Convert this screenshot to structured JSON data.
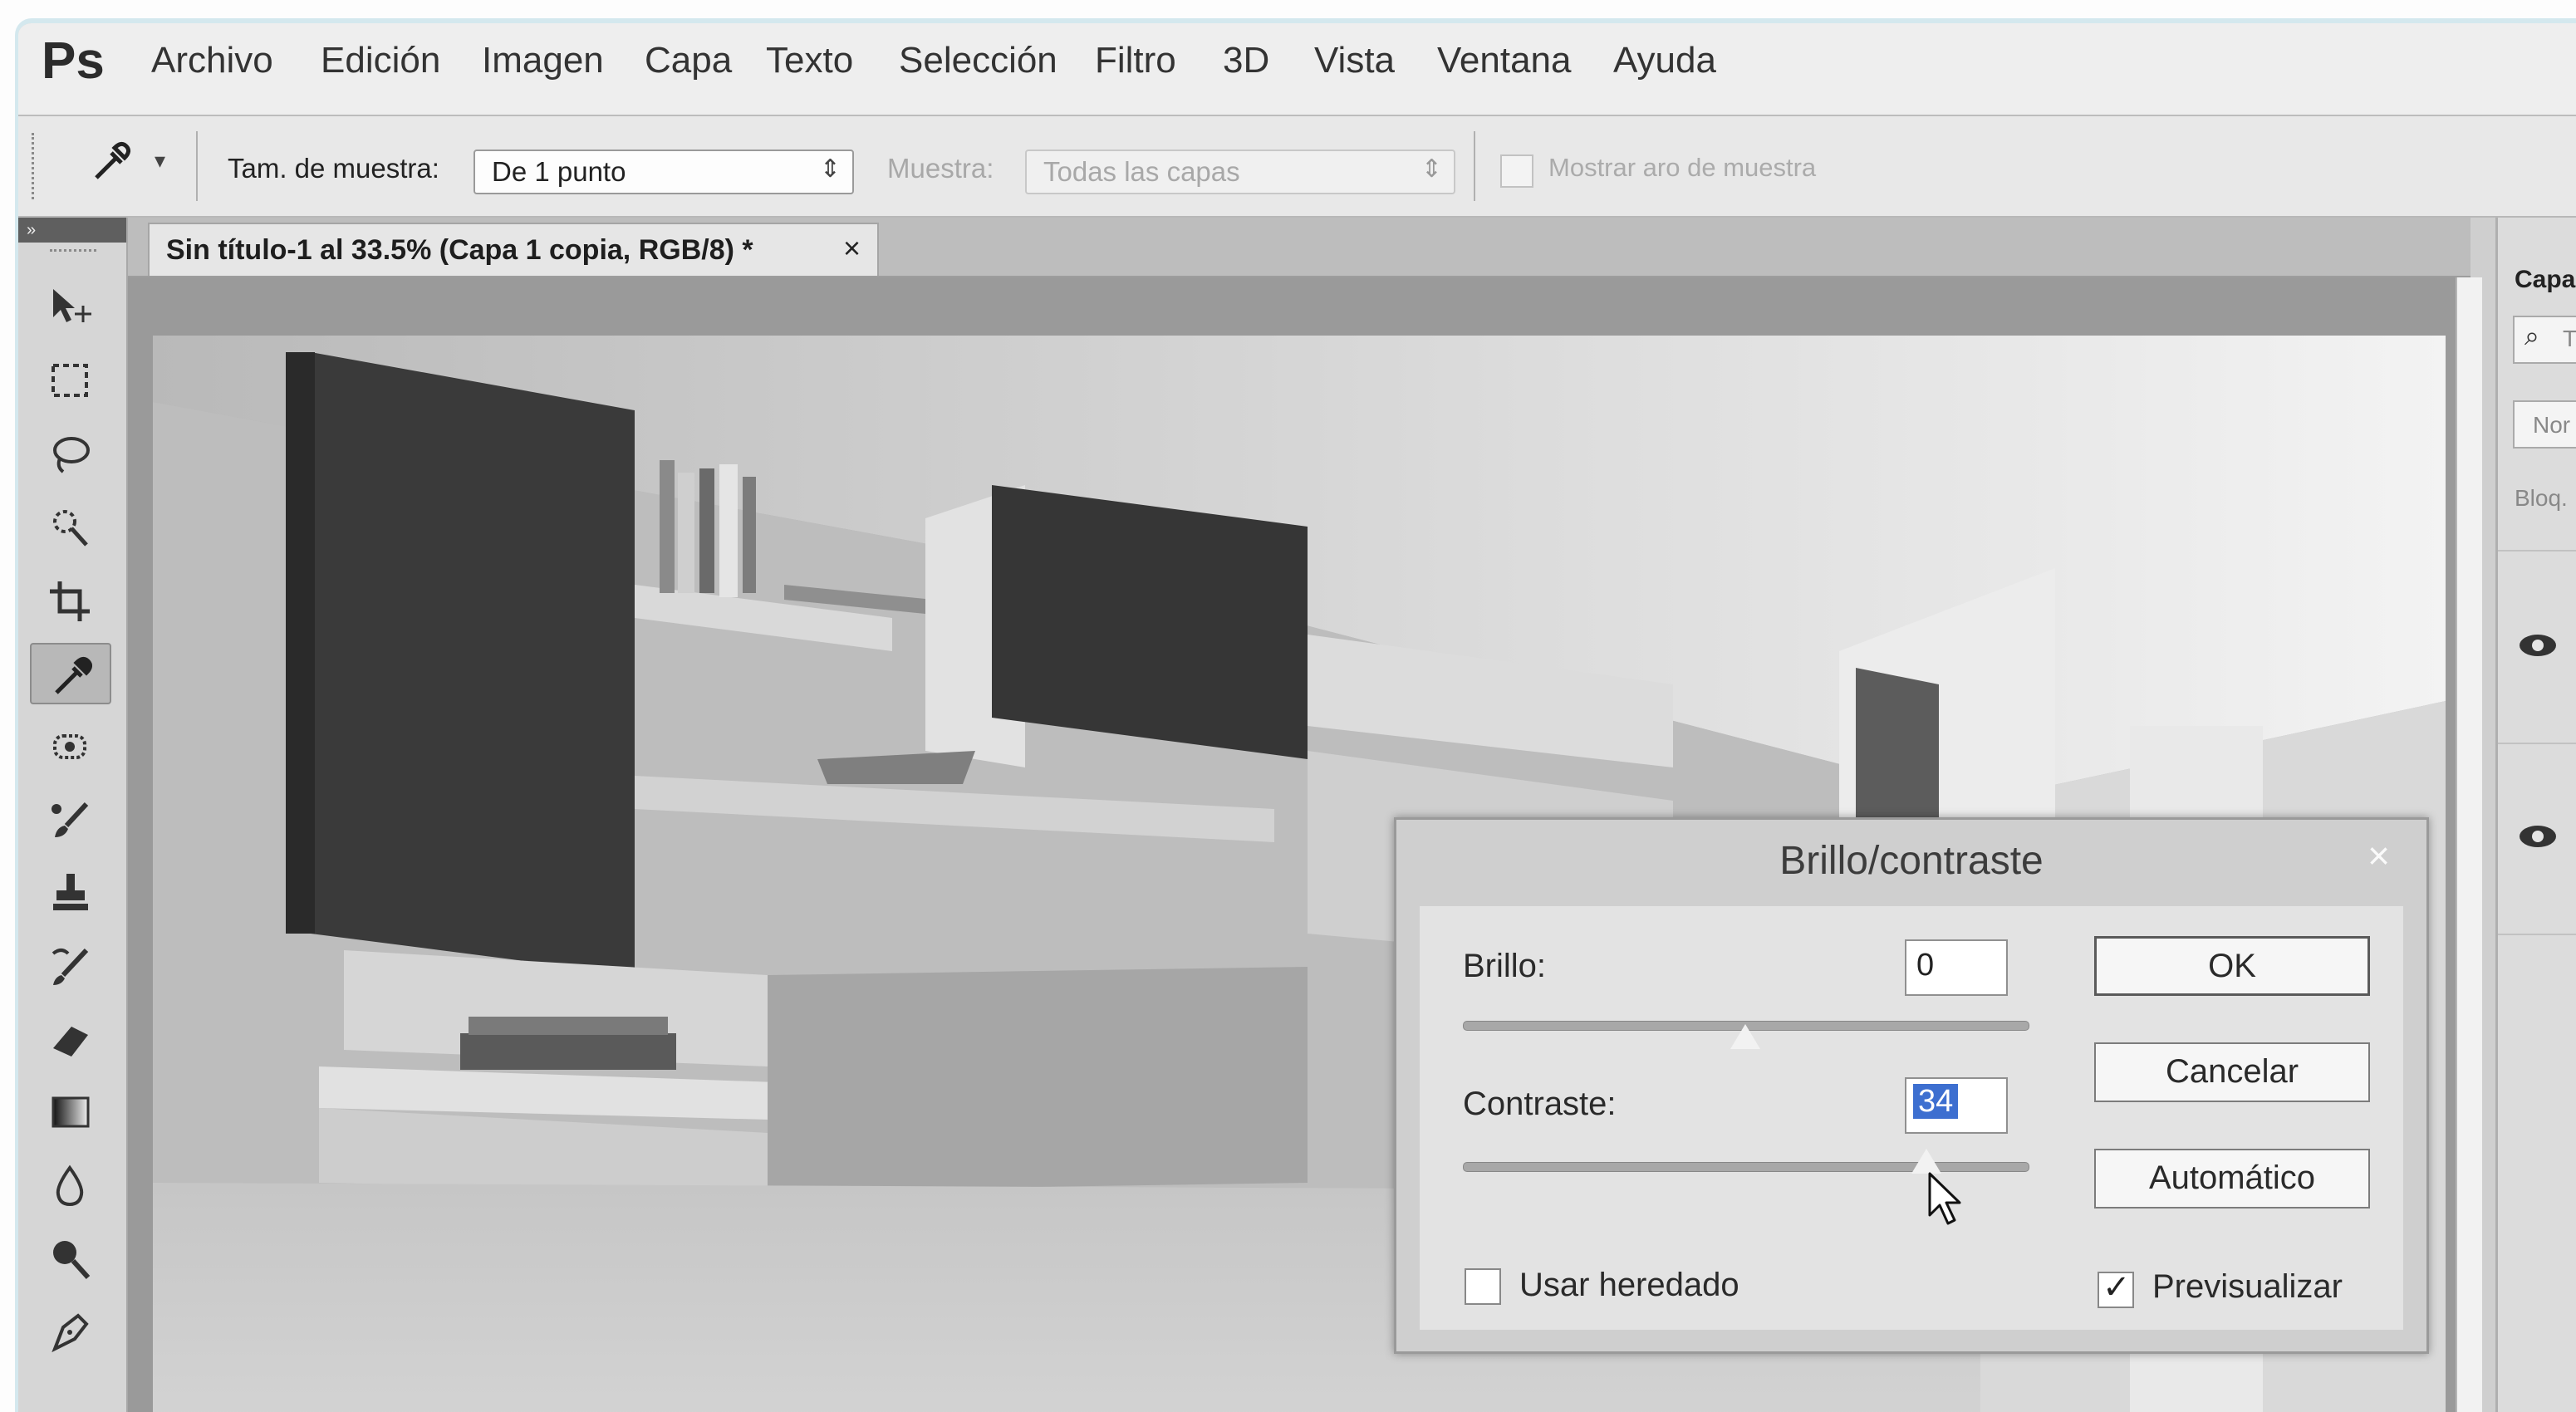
{
  "app": {
    "logo": "Ps"
  },
  "menu": [
    "Archivo",
    "Edición",
    "Imagen",
    "Capa",
    "Texto",
    "Selección",
    "Filtro",
    "3D",
    "Vista",
    "Ventana",
    "Ayuda"
  ],
  "options": {
    "sample_size_label": "Tam. de muestra:",
    "sample_size_value": "De 1 punto",
    "sample_label": "Muestra:",
    "sample_value": "Todas las capas",
    "show_ring_label": "Mostrar aro de muestra"
  },
  "document": {
    "tab_title": "Sin título-1 al 33.5% (Capa 1 copia, RGB/8) *",
    "close_glyph": "×"
  },
  "layers_panel": {
    "title": "Capa",
    "filter_text": "T",
    "blend_mode": "Nor",
    "lock_label": "Bloq."
  },
  "dialog": {
    "title": "Brillo/contraste",
    "close_glyph": "×",
    "brightness_label": "Brillo:",
    "brightness_value": "0",
    "contrast_label": "Contraste:",
    "contrast_value": "34",
    "ok_label": "OK",
    "cancel_label": "Cancelar",
    "auto_label": "Automático",
    "use_legacy_label": "Usar heredado",
    "use_legacy_checked": false,
    "preview_label": "Previsualizar",
    "preview_checked": true
  },
  "tools": [
    "move-tool-icon",
    "marquee-tool-icon",
    "lasso-tool-icon",
    "quick-selection-tool-icon",
    "crop-tool-icon",
    "eyedropper-tool-icon",
    "spot-healing-tool-icon",
    "brush-tool-icon",
    "clone-stamp-tool-icon",
    "history-brush-tool-icon",
    "eraser-tool-icon",
    "gradient-tool-icon",
    "blur-tool-icon",
    "dodge-tool-icon",
    "pen-tool-icon"
  ],
  "colors": {
    "accent_frame": "#d4e8ee",
    "dialog_close": "#fafafa"
  }
}
